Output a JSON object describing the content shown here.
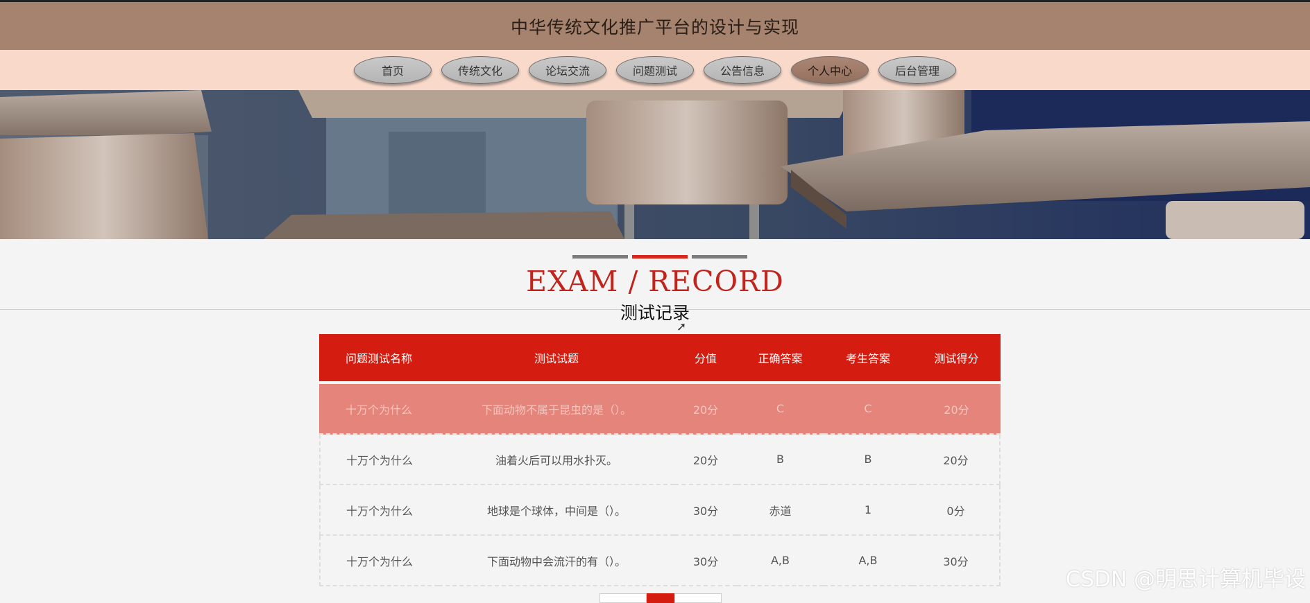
{
  "header": {
    "title": "中华传统文化推广平台的设计与实现"
  },
  "nav": {
    "items": [
      {
        "label": "首页"
      },
      {
        "label": "传统文化"
      },
      {
        "label": "论坛交流"
      },
      {
        "label": "问题测试"
      },
      {
        "label": "公告信息"
      },
      {
        "label": "个人中心"
      },
      {
        "label": "后台管理"
      }
    ],
    "active": "个人中心"
  },
  "section": {
    "title_en": "EXAM / RECORD",
    "title_cn": "测试记录"
  },
  "table": {
    "headers": [
      "问题测试名称",
      "测试试题",
      "分值",
      "正确答案",
      "考生答案",
      "测试得分"
    ],
    "rows": [
      [
        "十万个为什么",
        "下面动物不属于昆虫的是（）。",
        "20分",
        "C",
        "C",
        "20分"
      ],
      [
        "十万个为什么",
        "油着火后可以用水扑灭。",
        "20分",
        "B",
        "B",
        "20分"
      ],
      [
        "十万个为什么",
        "地球是个球体，中间是（）。",
        "30分",
        "赤道",
        "1",
        "0分"
      ],
      [
        "十万个为什么",
        "下面动物中会流汗的有（）。",
        "30分",
        "A,B",
        "A,B",
        "30分"
      ]
    ]
  },
  "watermark": "CSDN @明思计算机毕设",
  "colors": {
    "accent": "#d51c10",
    "header_bg": "#a5836f",
    "nav_bg": "#f8d9ca",
    "highlight_row": "#e5847b"
  }
}
